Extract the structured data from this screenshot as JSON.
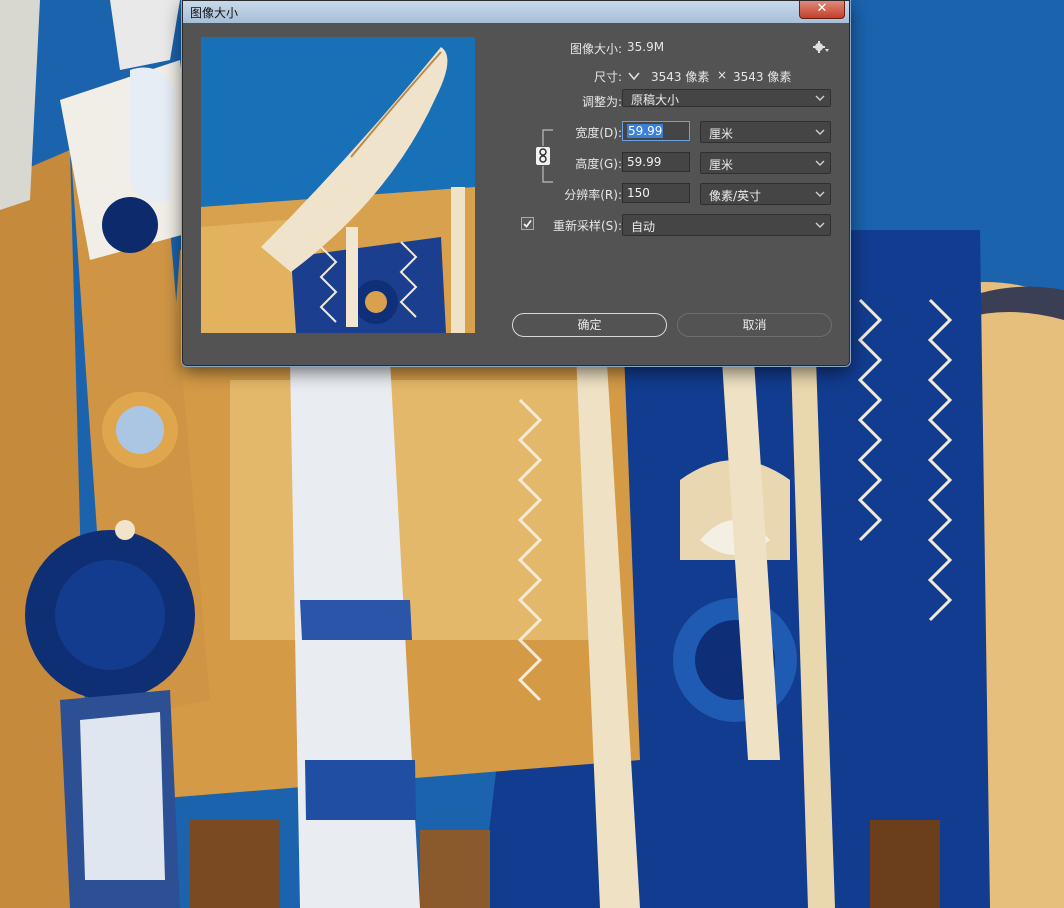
{
  "dialog": {
    "title": "图像大小",
    "close_symbol": "✕",
    "image_size_label": "图像大小:",
    "image_size_value": "35.9M",
    "settings_icon": "gear-icon",
    "dimensions_label": "尺寸:",
    "dimensions_width": "3543 像素",
    "dimensions_times": "×",
    "dimensions_height": "3543 像素",
    "fit_to_label": "调整为:",
    "fit_to_value": "原稿大小",
    "width_label": "宽度(D):",
    "width_value": "59.99",
    "width_unit": "厘米",
    "height_label": "高度(G):",
    "height_value": "59.99",
    "height_unit": "厘米",
    "resolution_label": "分辨率(R):",
    "resolution_value": "150",
    "resolution_unit": "像素/英寸",
    "resample_label": "重新采样(S):",
    "resample_checked": true,
    "resample_value": "自动",
    "ok_label": "确定",
    "cancel_label": "取消"
  },
  "colors": {
    "dialog_bg": "#535353",
    "field_bg": "#454545",
    "selection": "#3b7fd6",
    "sky_blue": "#1a6fb4",
    "gold": "#d9a14a",
    "navy": "#0f2f7a"
  }
}
